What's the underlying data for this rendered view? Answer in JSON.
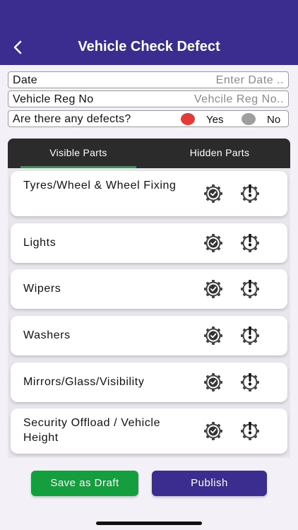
{
  "header": {
    "title": "Vehicle Check Defect",
    "back_icon": "chevron-left-icon",
    "background": "#3a2d8f"
  },
  "form": {
    "date": {
      "label": "Date",
      "placeholder": "Enter Date .."
    },
    "vehicle_reg": {
      "label": "Vehicle Reg No",
      "placeholder": "Vehcile Reg No.."
    },
    "defects": {
      "label": "Are there any defects?",
      "options": [
        {
          "label": "Yes",
          "color": "#e53935"
        },
        {
          "label": "No",
          "color": "#9e9e9e"
        }
      ]
    }
  },
  "tabs": [
    {
      "label": "Visible Parts",
      "active": true
    },
    {
      "label": "Hidden Parts",
      "active": false
    }
  ],
  "items": [
    {
      "label": "Tyres/Wheel & Wheel Fixing"
    },
    {
      "label": "Lights"
    },
    {
      "label": "Wipers"
    },
    {
      "label": "Washers"
    },
    {
      "label": "Mirrors/Glass/Visibility"
    },
    {
      "label": "Security Offload / Vehicle Height"
    }
  ],
  "item_icons": [
    "gear-check-icon",
    "gear-alert-icon"
  ],
  "buttons": {
    "draft": {
      "label": "Save as Draft",
      "color": "#159e3d"
    },
    "publish": {
      "label": "Publish",
      "color": "#3a2d8f"
    }
  }
}
